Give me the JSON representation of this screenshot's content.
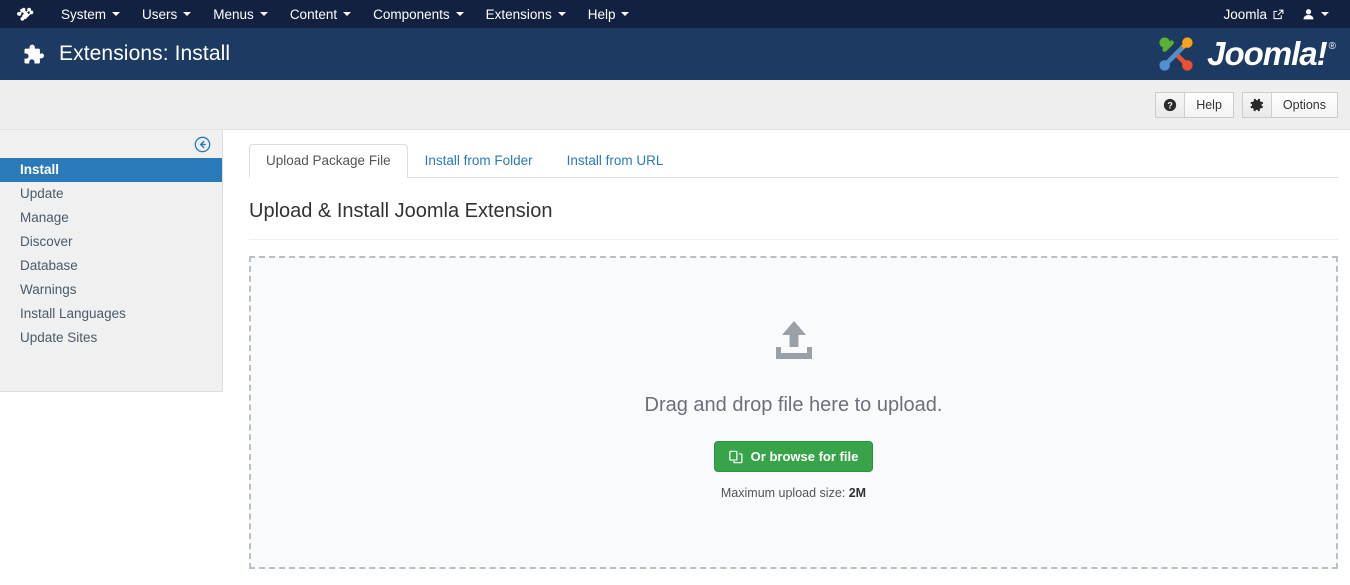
{
  "topbar": {
    "brand_icon": "joomla-brand-icon",
    "menu": [
      {
        "label": "System",
        "has_caret": true
      },
      {
        "label": "Users",
        "has_caret": true
      },
      {
        "label": "Menus",
        "has_caret": true
      },
      {
        "label": "Content",
        "has_caret": true
      },
      {
        "label": "Components",
        "has_caret": true
      },
      {
        "label": "Extensions",
        "has_caret": true
      },
      {
        "label": "Help",
        "has_caret": true
      }
    ],
    "site_link": {
      "label": "Joomla",
      "icon": "external-link-icon"
    },
    "user_menu": {
      "icon": "user-icon",
      "has_caret": true
    }
  },
  "header": {
    "icon": "puzzle-piece-icon",
    "title": "Extensions: Install",
    "logo_text": "Joomla!",
    "logo_mark": "joomla-logo-icon"
  },
  "toolbar": {
    "help_label": "Help",
    "help_icon": "question-circle-icon",
    "options_label": "Options",
    "options_icon": "gear-icon"
  },
  "sidebar": {
    "collapse_icon": "circle-arrow-left-icon",
    "items": [
      {
        "label": "Install",
        "active": true
      },
      {
        "label": "Update",
        "active": false
      },
      {
        "label": "Manage",
        "active": false
      },
      {
        "label": "Discover",
        "active": false
      },
      {
        "label": "Database",
        "active": false
      },
      {
        "label": "Warnings",
        "active": false
      },
      {
        "label": "Install Languages",
        "active": false
      },
      {
        "label": "Update Sites",
        "active": false
      }
    ]
  },
  "main": {
    "tabs": [
      {
        "label": "Upload Package File",
        "active": true
      },
      {
        "label": "Install from Folder",
        "active": false
      },
      {
        "label": "Install from URL",
        "active": false
      }
    ],
    "section_title": "Upload & Install Joomla Extension",
    "dropzone": {
      "icon": "upload-icon",
      "message": "Drag and drop file here to upload.",
      "browse_button_label": "Or browse for file",
      "browse_button_icon": "files-copy-icon",
      "max_size_label": "Maximum upload size:",
      "max_size_value": "2M"
    }
  },
  "colors": {
    "topbar_bg": "#12213f",
    "header_bg": "#1d3a63",
    "toolbar_bg": "#eeeeee",
    "sidebar_bg": "#f0f0f0",
    "active_item_bg": "#2a7ab9",
    "link_blue": "#2a7ab9",
    "button_green": "#38a44a",
    "dropzone_bg": "#f9fafb"
  }
}
